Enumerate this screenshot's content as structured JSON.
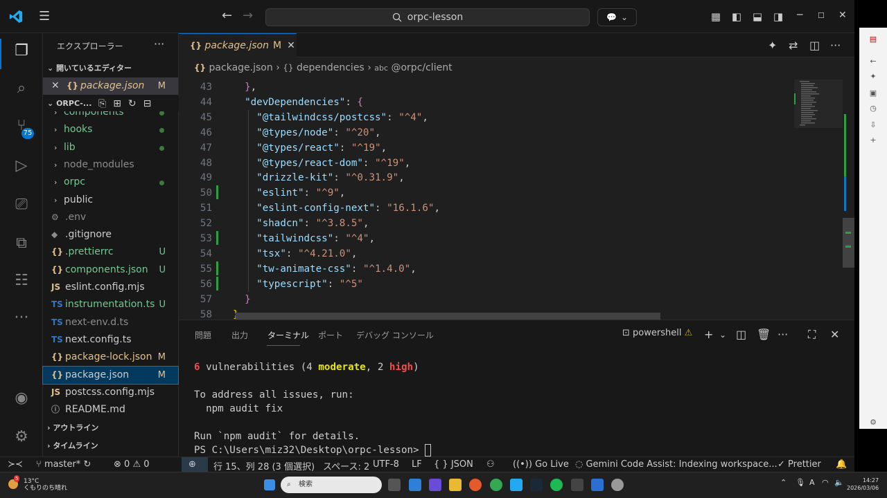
{
  "titlebar": {
    "search_text": "orpc-lesson",
    "back_icon": "←",
    "forward_icon": "→"
  },
  "activity": {
    "extensions_badge": "75"
  },
  "sidebar": {
    "title": "エクスプローラー",
    "open_editors_label": "開いているエディター",
    "open_editor_file": "package.json",
    "open_editor_status": "M",
    "project_label": "ORPC-...",
    "items": [
      {
        "name": "components",
        "type": "folder",
        "color": "green",
        "dot": true
      },
      {
        "name": "hooks",
        "type": "folder",
        "color": "green",
        "dot": true
      },
      {
        "name": "lib",
        "type": "folder",
        "color": "green",
        "dot": true
      },
      {
        "name": "node_modules",
        "type": "folder",
        "color": "gray"
      },
      {
        "name": "orpc",
        "type": "folder",
        "color": "green",
        "dot": true
      },
      {
        "name": "public",
        "type": "folder",
        "color": "white"
      },
      {
        "name": ".env",
        "icon": "⚙",
        "color": "gray"
      },
      {
        "name": ".gitignore",
        "icon": "◆",
        "color": "white"
      },
      {
        "name": ".prettierrc",
        "icon": "{}",
        "color": "green",
        "status": "U"
      },
      {
        "name": "components.json",
        "icon": "{}",
        "color": "green",
        "status": "U"
      },
      {
        "name": "eslint.config.mjs",
        "icon": "JS",
        "color": "white"
      },
      {
        "name": "instrumentation.ts",
        "icon": "TS",
        "color": "green",
        "status": "U"
      },
      {
        "name": "next-env.d.ts",
        "icon": "TS",
        "color": "gray"
      },
      {
        "name": "next.config.ts",
        "icon": "TS",
        "color": "white"
      },
      {
        "name": "package-lock.json",
        "icon": "{}",
        "color": "yellow",
        "status": "M"
      },
      {
        "name": "package.json",
        "icon": "{}",
        "color": "white",
        "status": "M",
        "selected": true
      },
      {
        "name": "postcss.config.mjs",
        "icon": "JS",
        "color": "white"
      },
      {
        "name": "README.md",
        "icon": "ⓘ",
        "color": "white"
      }
    ],
    "outline_label": "アウトライン",
    "timeline_label": "タイムライン"
  },
  "editor": {
    "tab_label": "package.json",
    "tab_status": "M",
    "breadcrumb": [
      "package.json",
      "dependencies",
      "@orpc/client"
    ],
    "lines": [
      {
        "n": "43",
        "text": "},",
        "kind": "close"
      },
      {
        "n": "44",
        "key": "devDependencies",
        "open": true
      },
      {
        "n": "45",
        "key": "@tailwindcss/postcss",
        "val": "^4"
      },
      {
        "n": "46",
        "key": "@types/node",
        "val": "^20"
      },
      {
        "n": "47",
        "key": "@types/react",
        "val": "^19"
      },
      {
        "n": "48",
        "key": "@types/react-dom",
        "val": "^19"
      },
      {
        "n": "49",
        "key": "drizzle-kit",
        "val": "^0.31.9",
        "mod": true
      },
      {
        "n": "50",
        "key": "eslint",
        "val": "^9"
      },
      {
        "n": "51",
        "key": "eslint-config-next",
        "val": "16.1.6"
      },
      {
        "n": "52",
        "key": "shadcn",
        "val": "^3.8.5",
        "mod": true
      },
      {
        "n": "53",
        "key": "tailwindcss",
        "val": "^4"
      },
      {
        "n": "54",
        "key": "tsx",
        "val": "^4.21.0",
        "mod": true
      },
      {
        "n": "55",
        "key": "tw-animate-css",
        "val": "^1.4.0",
        "mod": true
      },
      {
        "n": "56",
        "key": "typescript",
        "val": "^5",
        "last": true
      },
      {
        "n": "57",
        "text": "}",
        "kind": "close2"
      },
      {
        "n": "58",
        "text": "}",
        "kind": "close3"
      }
    ]
  },
  "panel": {
    "tabs": [
      "問題",
      "出力",
      "ターミナル",
      "ポート",
      "デバッグ コンソール"
    ],
    "shell": "powershell",
    "terminal": {
      "vuln_count": "6",
      "vuln_text_a": " vulnerabilities (4 ",
      "moderate": "moderate",
      "vuln_text_b": ", 2 ",
      "high": "high",
      "vuln_text_c": ")",
      "line2": "To address all issues, run:",
      "line3": "  npm audit fix",
      "line4": "Run `npm audit` for details.",
      "prompt": "PS C:\\Users\\miz32\\Desktop\\orpc-lesson> "
    }
  },
  "statusbar": {
    "branch": "master*",
    "errors": "0",
    "warnings": "0",
    "cursor_pos": "行 15、列 28 (3 個選択)",
    "spaces": "スペース: 2",
    "encoding": "UTF-8",
    "eol": "LF",
    "language": "JSON",
    "golive": "Go Live",
    "gemini": "Gemini Code Assist: Indexing workspace...",
    "prettier": "Prettier"
  },
  "taskbar": {
    "weather_temp": "13°C",
    "weather_desc": "くもりのち晴れ",
    "weather_badge": "5",
    "search_placeholder": "検索",
    "time": "14:27",
    "date": "2026/03/06"
  }
}
